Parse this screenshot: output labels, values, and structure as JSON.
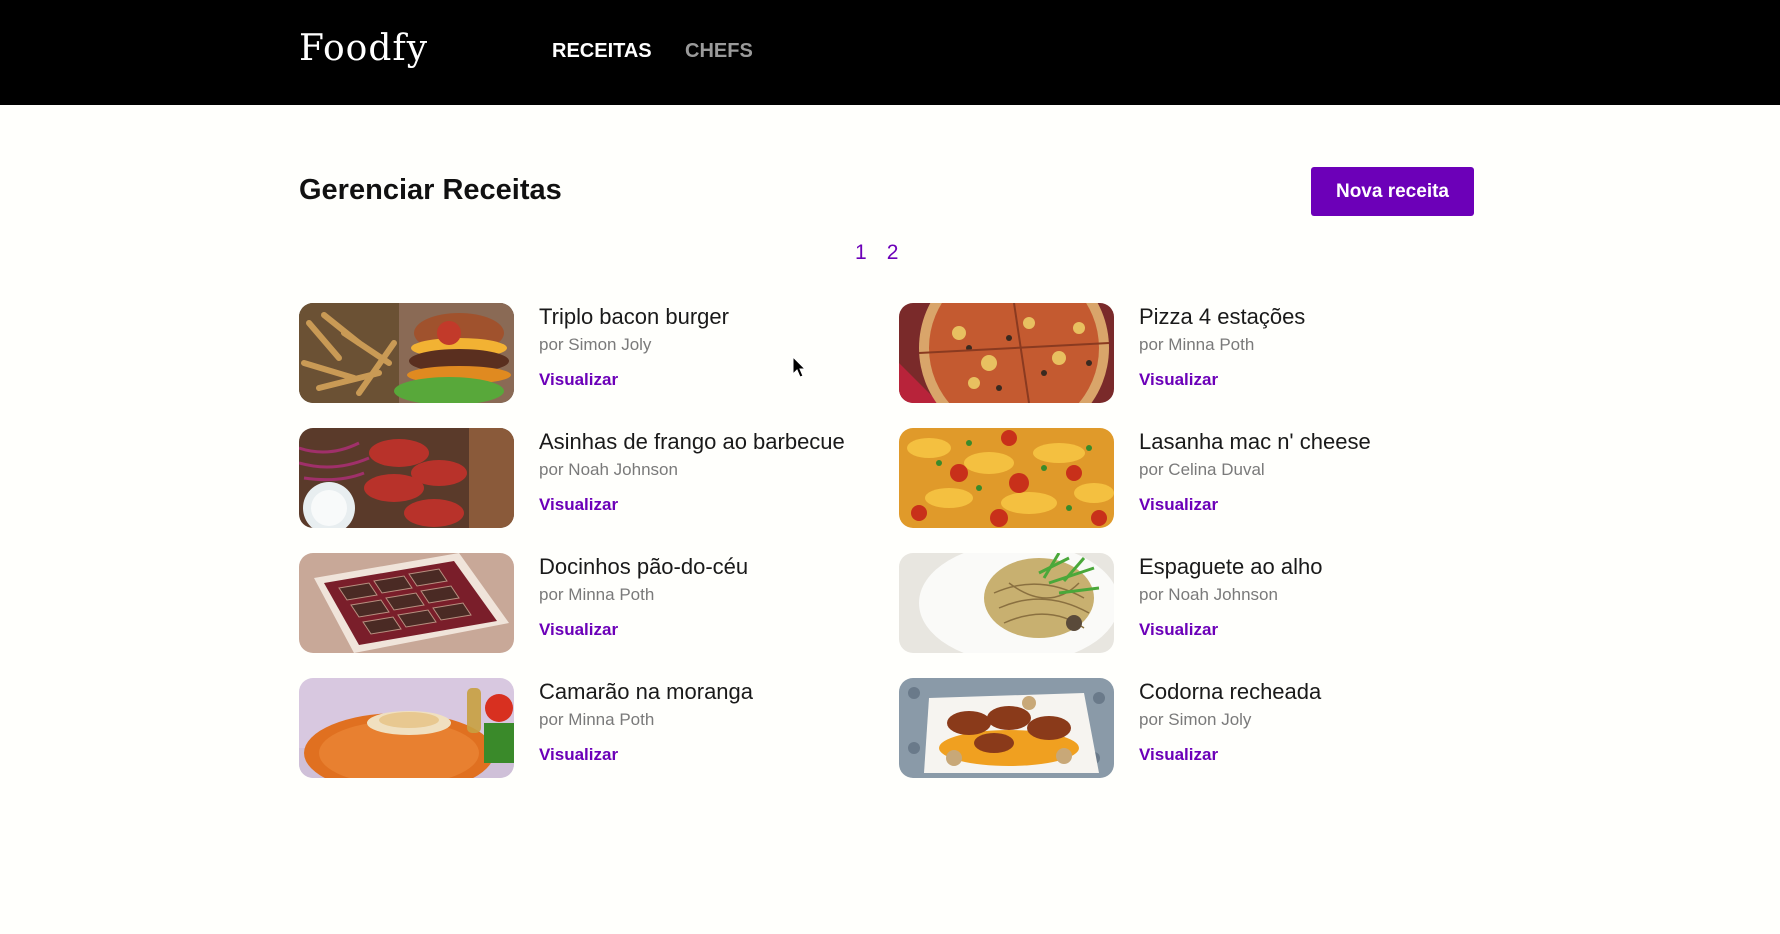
{
  "brand": {
    "name": "Foodfy"
  },
  "nav": {
    "items": [
      {
        "label": "RECEITAS"
      },
      {
        "label": "CHEFS"
      }
    ]
  },
  "page": {
    "title": "Gerenciar Receitas",
    "new_button": "Nova receita"
  },
  "pagination": {
    "pages": [
      "1",
      "2"
    ]
  },
  "recipes": [
    {
      "title": "Triplo bacon burger",
      "author": "por Simon Joly",
      "action": "Visualizar"
    },
    {
      "title": "Pizza 4 estações",
      "author": "por Minna Poth",
      "action": "Visualizar"
    },
    {
      "title": "Asinhas de frango ao barbecue",
      "author": "por Noah Johnson",
      "action": "Visualizar"
    },
    {
      "title": "Lasanha mac n' cheese",
      "author": "por Celina Duval",
      "action": "Visualizar"
    },
    {
      "title": "Docinhos pão-do-céu",
      "author": "por Minna Poth",
      "action": "Visualizar"
    },
    {
      "title": "Espaguete ao alho",
      "author": "por Noah Johnson",
      "action": "Visualizar"
    },
    {
      "title": "Camarão na moranga",
      "author": "por Minna Poth",
      "action": "Visualizar"
    },
    {
      "title": "Codorna recheada",
      "author": "por Simon Joly",
      "action": "Visualizar"
    }
  ],
  "colors": {
    "accent": "#6c00b8",
    "header_bg": "#000000",
    "page_bg": "#fffffc"
  }
}
